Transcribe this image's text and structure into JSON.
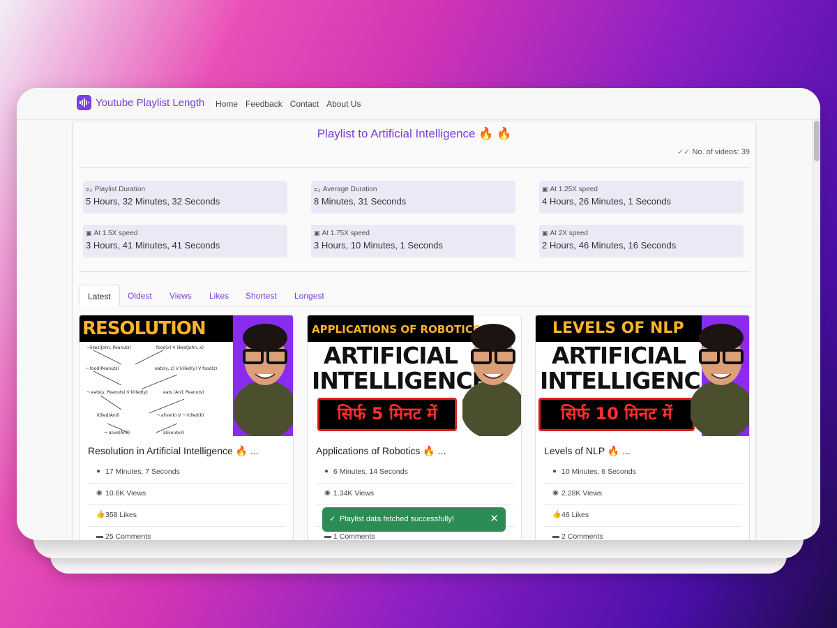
{
  "navbar": {
    "brand": "Youtube Playlist Length",
    "links": [
      "Home",
      "Feedback",
      "Contact",
      "About Us"
    ]
  },
  "playlist": {
    "title": "Playlist to Artificial Intelligence",
    "count_text": "No. of videos: 39"
  },
  "stats": [
    {
      "label": "Playlist Duration",
      "value": "5 Hours, 32 Minutes, 32 Seconds",
      "icon": "playlist-icon"
    },
    {
      "label": "Average Duration",
      "value": "8 Minutes, 31 Seconds",
      "icon": "playlist-icon"
    },
    {
      "label": "At 1.25X speed",
      "value": "4 Hours, 26 Minutes, 1 Seconds",
      "icon": "video-icon"
    },
    {
      "label": "At 1.5X speed",
      "value": "3 Hours, 41 Minutes, 41 Seconds",
      "icon": "video-icon"
    },
    {
      "label": "At 1.75X speed",
      "value": "3 Hours, 10 Minutes, 1 Seconds",
      "icon": "video-icon"
    },
    {
      "label": "At 2X speed",
      "value": "2 Hours, 46 Minutes, 16 Seconds",
      "icon": "video-icon"
    }
  ],
  "tabs": [
    "Latest",
    "Oldest",
    "Views",
    "Likes",
    "Shortest",
    "Longest"
  ],
  "active_tab": "Latest",
  "cards": [
    {
      "thumb_text": "RESOLUTION",
      "title": "Resolution in Artificial Intelligence",
      "ellipsis": "...",
      "duration": "17 Minutes, 7 Seconds",
      "views": "10.6K Views",
      "likes": "358 Likes",
      "comments": "25 Comments"
    },
    {
      "thumb_text": "APPLICATIONS OF ROBOTICS",
      "thumb_big": "ARTIFICIAL INTELLIGENCE",
      "thumb_hindi": "सिर्फ 5 मिनट में",
      "title": "Applications of Robotics",
      "ellipsis": "...",
      "duration": "6 Minutes, 14 Seconds",
      "views": "1.34K Views",
      "likes": "",
      "comments": "1 Comments"
    },
    {
      "thumb_text": "LEVELS OF NLP",
      "thumb_big": "ARTIFICIAL INTELLIGENCE",
      "thumb_hindi": "सिर्फ 10 मिनट में",
      "title": "Levels of NLP",
      "ellipsis": "...",
      "duration": "10 Minutes, 6 Seconds",
      "views": "2.28K Views",
      "likes": "46 Likes",
      "comments": "2 Comments"
    }
  ],
  "toast": {
    "text": "Playlist data fetched successfully!"
  },
  "colors": {
    "accent": "#7b3fd7",
    "stat_bg": "#ede8f5",
    "toast_bg": "#2b8c55"
  }
}
